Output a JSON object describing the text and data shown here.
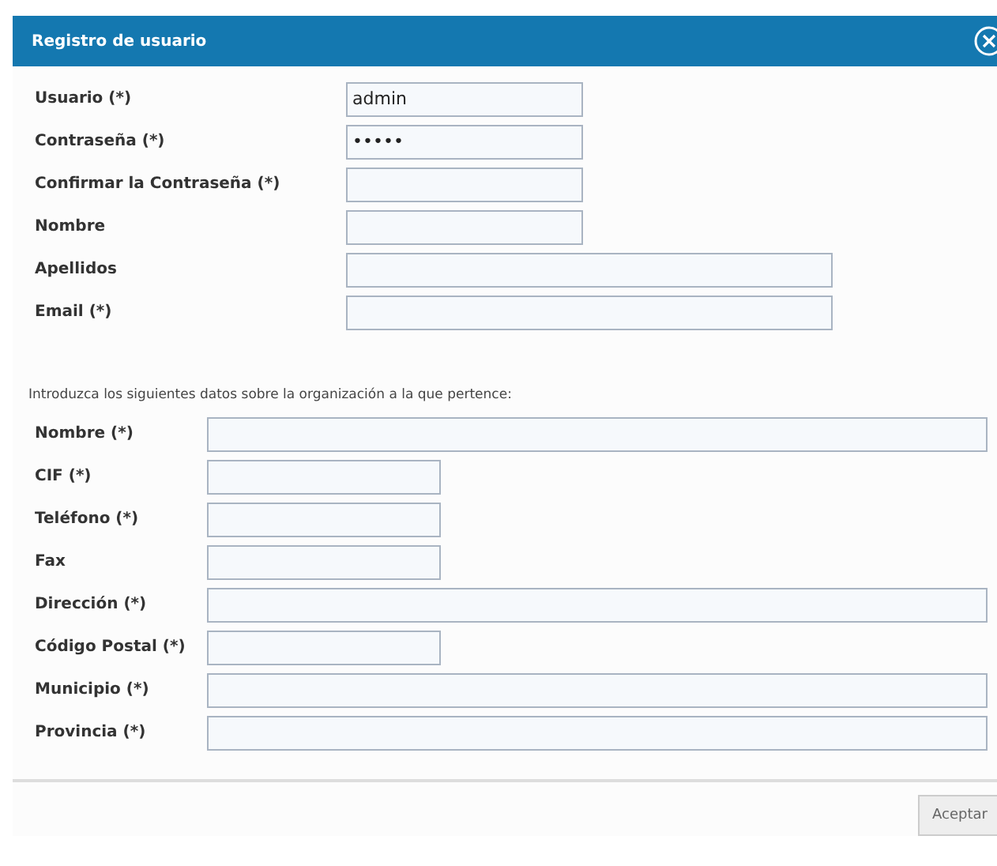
{
  "window": {
    "title": "Registro de usuario"
  },
  "user_fields": [
    {
      "label": "Usuario (*)",
      "value": "admin",
      "kind": "short"
    },
    {
      "label": "Contraseña (*)",
      "value": "•••••",
      "kind": "short"
    },
    {
      "label": "Confirmar la Contraseña (*)",
      "kind": "short"
    },
    {
      "label": "Nombre",
      "kind": "short"
    },
    {
      "label": "Apellidos",
      "kind": "long"
    },
    {
      "label": "Email (*)",
      "kind": "long"
    }
  ],
  "organization": {
    "intro": "Introduzca los siguientes datos sobre la organización a la que pertence:",
    "fields": [
      {
        "label": "Nombre (*)",
        "kind": "long"
      },
      {
        "label": "CIF (*)",
        "kind": "short"
      },
      {
        "label": "Teléfono (*)",
        "kind": "short"
      },
      {
        "label": "Fax",
        "kind": "short"
      },
      {
        "label": "Dirección (*)",
        "kind": "long"
      },
      {
        "label": "Código Postal (*)",
        "kind": "short"
      },
      {
        "label": "Municipio (*)",
        "kind": "long"
      },
      {
        "label": "Provincia (*)",
        "kind": "long"
      }
    ]
  },
  "buttons": [
    "Aceptar"
  ]
}
